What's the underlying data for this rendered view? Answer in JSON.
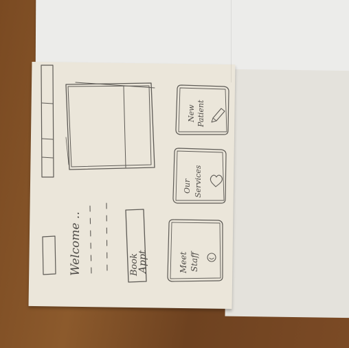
{
  "sketch": {
    "welcome_text": "Welcome ..",
    "book_appt_line1": "Book",
    "book_appt_line2": "Appt",
    "card_new_patient_line1": "New",
    "card_new_patient_line2": "Patient",
    "card_our_services_line1": "Our",
    "card_our_services_line2": "Services",
    "card_meet_staff_line1": "Meet",
    "card_meet_staff_line2": "Staff",
    "icons": [
      "pencil-icon",
      "heart-icon",
      "smiley-icon"
    ],
    "colors": {
      "table": "#7a4a22",
      "paper": "#ebe6da",
      "pencil": "#5d5a55"
    }
  }
}
